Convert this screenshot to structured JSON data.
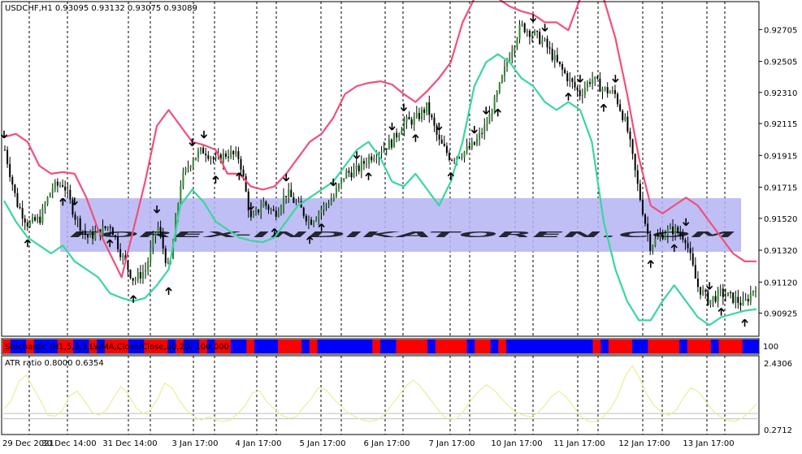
{
  "colors": {
    "upper_band": "#f0507a",
    "lower_band": "#3ad79a",
    "candle": "#000000",
    "grid": "#000000",
    "watermark_band": "#b4b4f5",
    "watermark_text": "#c8a0f0",
    "stoch_red": "#ff0000",
    "stoch_blue": "#0000ff",
    "atr_line": "#ecec9a",
    "atr_level": "#bfbfbf"
  },
  "main": {
    "header": "USDCHF,H1  0.93095 0.93132 0.93075 0.93089",
    "watermark": "FOREX-INDIKATOREN.COM"
  },
  "stoch": {
    "label": "Stochastic (H1,5,3,3,LWMA,Close/Close,80,20) 100.000",
    "right_label": "100"
  },
  "atr": {
    "label": "ATR ratio 0.8000 0.6354",
    "axis_labels": [
      "2.4306",
      "0.2712"
    ]
  },
  "icons": [
    "arrow-up-icon",
    "arrow-down-icon"
  ],
  "chart_data": [
    {
      "type": "line",
      "title": "USDCHF,H1",
      "ohlc_last": {
        "open": 0.93095,
        "high": 0.93132,
        "low": 0.93075,
        "close": 0.93089
      },
      "x_tick_labels": [
        "29 Dec 2021",
        "30 Dec 14:00",
        "31 Dec 14:00",
        "3 Jan 17:00",
        "4 Jan 17:00",
        "5 Jan 17:00",
        "6 Jan 17:00",
        "7 Jan 17:00",
        "10 Jan 17:00",
        "11 Jan 17:00",
        "12 Jan 17:00",
        "13 Jan 17:00"
      ],
      "y_tick_labels": [
        "0.92705",
        "0.92505",
        "0.92310",
        "0.92115",
        "0.91915",
        "0.91715",
        "0.91520",
        "0.91320",
        "0.91120",
        "0.90925"
      ],
      "ylim": [
        0.9078,
        0.9288
      ],
      "grid": true,
      "x": [
        0,
        4,
        8,
        12,
        16,
        20,
        24,
        28,
        32,
        36,
        40,
        44,
        48,
        52,
        56,
        60,
        64,
        68,
        72,
        76,
        80,
        84,
        88,
        92,
        96,
        100,
        104,
        108,
        112,
        116,
        120,
        124,
        128,
        132,
        136,
        140,
        144,
        148,
        152,
        156,
        160,
        164,
        168,
        172,
        176,
        180,
        184,
        188,
        192,
        196,
        200,
        204,
        208,
        212,
        216,
        220,
        224,
        228,
        232,
        236,
        240,
        244,
        248,
        252,
        256
      ],
      "series": [
        {
          "values": [
            0.9195,
            0.9162,
            0.9148,
            0.9152,
            0.9171,
            0.9174,
            0.9153,
            0.914,
            0.9143,
            0.9148,
            0.9128,
            0.9113,
            0.912,
            0.9148,
            0.9118,
            0.9175,
            0.919,
            0.9195,
            0.9188,
            0.9193,
            0.919,
            0.915,
            0.9162,
            0.9155,
            0.9168,
            0.916,
            0.915,
            0.9158,
            0.9165,
            0.918,
            0.9182,
            0.919,
            0.9195,
            0.92,
            0.9212,
            0.9214,
            0.9222,
            0.92,
            0.919,
            0.9193,
            0.9198,
            0.921,
            0.923,
            0.9255,
            0.9273,
            0.9268,
            0.9262,
            0.925,
            0.924,
            0.923,
            0.924,
            0.9233,
            0.923,
            0.921,
            0.917,
            0.9135,
            0.9142,
            0.9145,
            0.914,
            0.911,
            0.91,
            0.9105,
            0.9102,
            0.9098,
            0.911
          ]
        },
        {
          "values": [
            0.9203,
            0.9205,
            0.92,
            0.9185,
            0.918,
            0.9181,
            0.918,
            0.9165,
            0.9145,
            0.913,
            0.9115,
            0.9145,
            0.9175,
            0.921,
            0.922,
            0.921,
            0.92,
            0.9198,
            0.9195,
            0.918,
            0.918,
            0.9172,
            0.917,
            0.9172,
            0.918,
            0.919,
            0.92,
            0.9205,
            0.9215,
            0.923,
            0.9235,
            0.9237,
            0.9238,
            0.9236,
            0.923,
            0.9225,
            0.9232,
            0.924,
            0.925,
            0.9275,
            0.929,
            0.929,
            0.929,
            0.9285,
            0.9282,
            0.928,
            0.9275,
            0.9275,
            0.927,
            0.929,
            0.929,
            0.929,
            0.9265,
            0.923,
            0.919,
            0.916,
            0.9155,
            0.916,
            0.9165,
            0.916,
            0.915,
            0.914,
            0.913,
            0.9125,
            0.9125
          ]
        },
        {
          "values": [
            0.9163,
            0.915,
            0.914,
            0.9135,
            0.913,
            0.9135,
            0.9125,
            0.912,
            0.9115,
            0.9105,
            0.9102,
            0.91,
            0.9102,
            0.911,
            0.912,
            0.916,
            0.917,
            0.9162,
            0.915,
            0.9145,
            0.914,
            0.9138,
            0.9137,
            0.914,
            0.915,
            0.916,
            0.9165,
            0.917,
            0.9175,
            0.9185,
            0.9195,
            0.92,
            0.919,
            0.9175,
            0.9172,
            0.918,
            0.917,
            0.916,
            0.9175,
            0.92,
            0.9235,
            0.925,
            0.9255,
            0.925,
            0.924,
            0.9235,
            0.9225,
            0.922,
            0.9225,
            0.922,
            0.92,
            0.915,
            0.912,
            0.91,
            0.9088,
            0.9088,
            0.91,
            0.911,
            0.91,
            0.909,
            0.9085,
            0.909,
            0.9092,
            0.9094,
            0.9095
          ]
        }
      ]
    },
    {
      "type": "heatmap",
      "title": "Stochastic (H1,5,3,3,LWMA,Close/Close,80,20) 100.000",
      "categories": [
        "red",
        "blue"
      ],
      "values": [
        1,
        0,
        0,
        1,
        0,
        0,
        0,
        1,
        1,
        0,
        0,
        1,
        0,
        1,
        1,
        1,
        0,
        0,
        1,
        1,
        1,
        0,
        1,
        0,
        0,
        1,
        0,
        1,
        1,
        0,
        0,
        1,
        0,
        0,
        0,
        1,
        1,
        1,
        0,
        1,
        0,
        0,
        0,
        0,
        0,
        0,
        0,
        1,
        0,
        0,
        1,
        1,
        1,
        1,
        0,
        1,
        1,
        1,
        1,
        0,
        1,
        1,
        0,
        1,
        0,
        0,
        0,
        0,
        0,
        0,
        0,
        0,
        0,
        0,
        0,
        1,
        0,
        1,
        1,
        1,
        0,
        0,
        1,
        1,
        1,
        1,
        0,
        1,
        1,
        1,
        0,
        1,
        1,
        1,
        0,
        0
      ]
    },
    {
      "type": "line",
      "title": "ATR ratio 0.8000 0.6354",
      "y_tick_labels": [
        "2.4306",
        "0.2712"
      ],
      "ylim": [
        0.2712,
        2.4306
      ],
      "levels": [
        0.8,
        0.6354
      ],
      "values": [
        0.95,
        1.2,
        1.8,
        2.0,
        1.6,
        1.2,
        0.75,
        0.72,
        0.9,
        1.35,
        1.5,
        1.2,
        0.85,
        0.75,
        0.9,
        1.3,
        1.65,
        1.4,
        1.0,
        0.8,
        0.9,
        1.25,
        1.75,
        1.6,
        1.2,
        0.9,
        0.7,
        0.6,
        0.7,
        0.6,
        0.55,
        0.6,
        0.8,
        1.05,
        1.45,
        1.5,
        1.15,
        0.95,
        0.75,
        0.65,
        0.7,
        1.0,
        1.25,
        1.6,
        1.55,
        1.3,
        1.05,
        0.85,
        0.7,
        0.6,
        0.55,
        0.6,
        0.75,
        1.05,
        1.35,
        1.65,
        1.85,
        1.65,
        1.35,
        1.05,
        0.75,
        0.6,
        0.65,
        0.9,
        1.25,
        1.5,
        1.7,
        1.55,
        1.3,
        1.05,
        0.85,
        0.75,
        0.7,
        0.8,
        1.05,
        1.35,
        1.5,
        1.3,
        1.0,
        0.7,
        0.55,
        0.55,
        0.7,
        0.95,
        1.35,
        1.95,
        2.3,
        1.9,
        1.4,
        1.05,
        0.85,
        0.75,
        0.9,
        1.3,
        1.6,
        1.5,
        1.2,
        0.9,
        0.7,
        0.6,
        0.55,
        0.65,
        0.85,
        1.1
      ]
    }
  ]
}
